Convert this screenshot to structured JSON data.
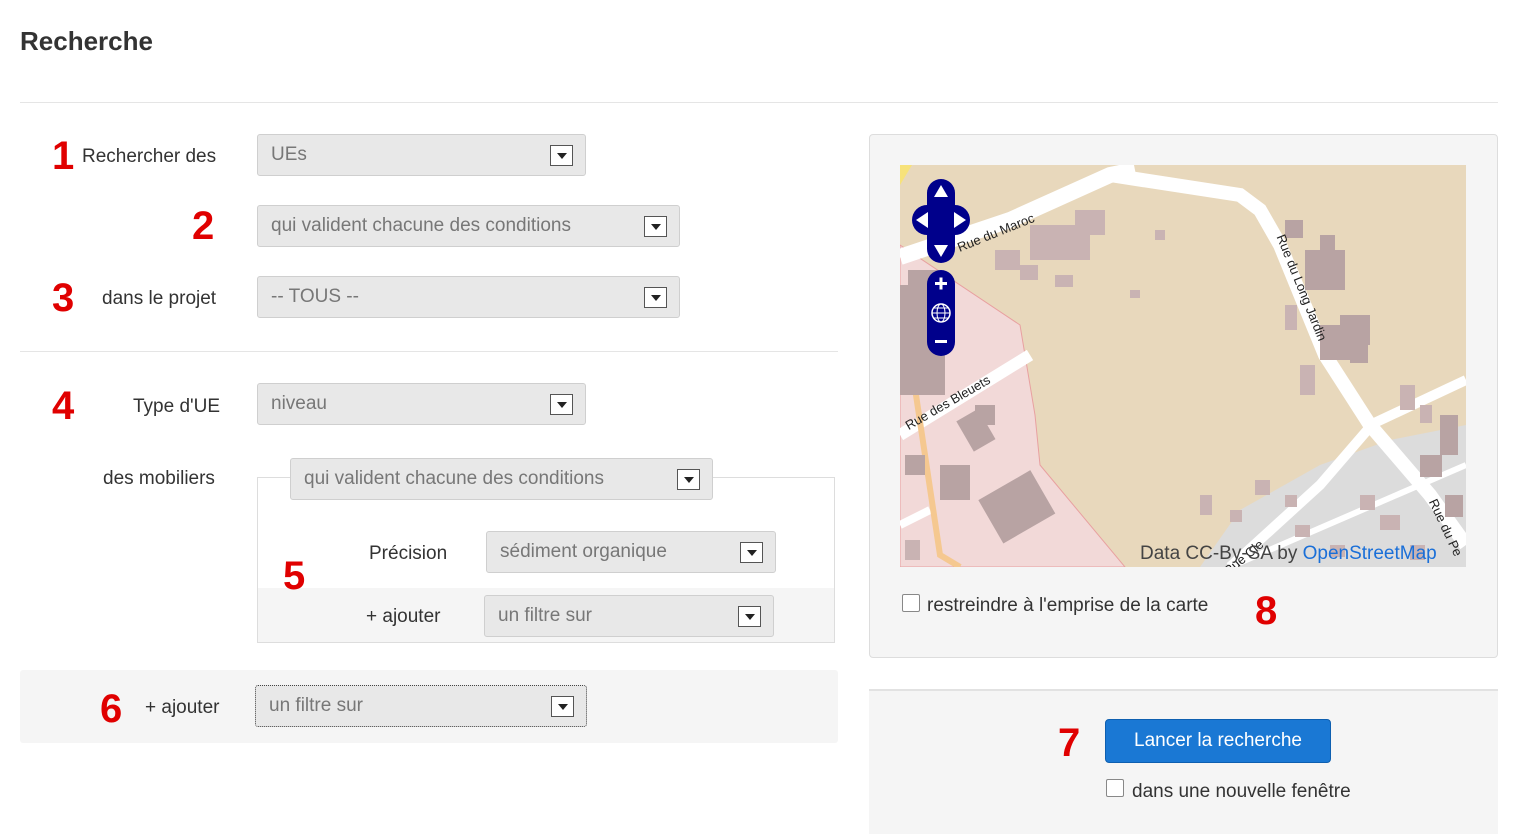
{
  "page": {
    "title": "Recherche"
  },
  "form": {
    "search_label": "Rechercher des",
    "search_value": "UEs",
    "conditions_value": "qui valident chacune des conditions",
    "project_label": "dans le projet",
    "project_value": "-- TOUS --",
    "type_label": "Type d'UE",
    "type_value": "niveau",
    "mobiliers_label": "des mobiliers",
    "mobiliers_conditions_value": "qui valident chacune des conditions",
    "precision_label": "Précision",
    "precision_value": "sédiment organique",
    "inner_add_label": "+ ajouter",
    "inner_filter_value": "un filtre sur",
    "outer_add_label": "+ ajouter",
    "outer_filter_value": "un filtre sur"
  },
  "markers": [
    "1",
    "2",
    "3",
    "4",
    "5",
    "6",
    "7",
    "8"
  ],
  "map": {
    "streets": {
      "maroc": "Rue du Maroc",
      "bleuets": "Rue des Bleuets",
      "long_jardin": "Rue du Long Jardin",
      "pe": "Rue du Pe",
      "ie": "Rue Cle"
    },
    "attribution_prefix": "Data CC-By-SA by ",
    "attribution_link": "OpenStreetMap",
    "restrict_label": "restreindre à l'emprise de la carte"
  },
  "actions": {
    "launch_label": "Lancer la recherche",
    "new_window_label": "dans une nouvelle fenêtre"
  },
  "colors": {
    "marker": "#e00000",
    "button": "#1a78d4",
    "map_control": "#00008b"
  }
}
